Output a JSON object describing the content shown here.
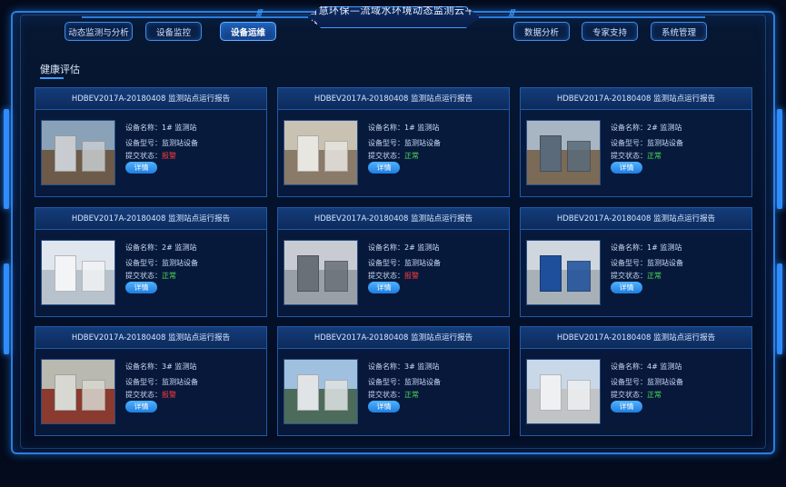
{
  "header": {
    "title": "智慧环保—流域水环境动态监测云平台"
  },
  "nav": [
    {
      "label": "动态监测与分析",
      "active": false
    },
    {
      "label": "设备监控",
      "active": false
    },
    {
      "label": "设备运维",
      "active": true
    },
    {
      "label": "数据分析",
      "active": false
    },
    {
      "label": "专家支持",
      "active": false
    },
    {
      "label": "系统管理",
      "active": false
    }
  ],
  "section": {
    "title": "健康评估"
  },
  "labels": {
    "name": "设备名称：",
    "model": "设备型号：",
    "status": "提交状态：",
    "detail": "详情"
  },
  "colors": {
    "ok": "#4fdc5a",
    "warn": "#ff3b3b",
    "accent": "#3d9cff"
  },
  "cards": [
    {
      "title": "HDBEV2017A-20180408 监测站点运行报告",
      "name": "1# 监测站",
      "model": "监测站设备",
      "status": "报警",
      "status_type": "warn",
      "image": "rooftop-station"
    },
    {
      "title": "HDBEV2017A-20180408 监测站点运行报告",
      "name": "1# 监测站",
      "model": "监测站设备",
      "status": "正常",
      "status_type": "ok",
      "image": "indoor-room"
    },
    {
      "title": "HDBEV2017A-20180408 监测站点运行报告",
      "name": "2# 监测站",
      "model": "监测站设备",
      "status": "正常",
      "status_type": "ok",
      "image": "mountain-station"
    },
    {
      "title": "HDBEV2017A-20180408 监测站点运行报告",
      "name": "2# 监测站",
      "model": "监测站设备",
      "status": "正常",
      "status_type": "ok",
      "image": "lab-cabinets"
    },
    {
      "title": "HDBEV2017A-20180408 监测站点运行报告",
      "name": "2# 监测站",
      "model": "监测站设备",
      "status": "报警",
      "status_type": "warn",
      "image": "server-cabinets"
    },
    {
      "title": "HDBEV2017A-20180408 监测站点运行报告",
      "name": "1# 监测站",
      "model": "监测站设备",
      "status": "正常",
      "status_type": "ok",
      "image": "blue-cabinet"
    },
    {
      "title": "HDBEV2017A-20180408 监测站点运行报告",
      "name": "3# 监测站",
      "model": "监测站设备",
      "status": "报警",
      "status_type": "warn",
      "image": "equipment-room"
    },
    {
      "title": "HDBEV2017A-20180408 监测站点运行报告",
      "name": "3# 监测站",
      "model": "监测站设备",
      "status": "正常",
      "status_type": "ok",
      "image": "water-plant"
    },
    {
      "title": "HDBEV2017A-20180408 监测站点运行报告",
      "name": "4# 监测站",
      "model": "监测站设备",
      "status": "正常",
      "status_type": "ok",
      "image": "outdoor-shelter"
    }
  ]
}
